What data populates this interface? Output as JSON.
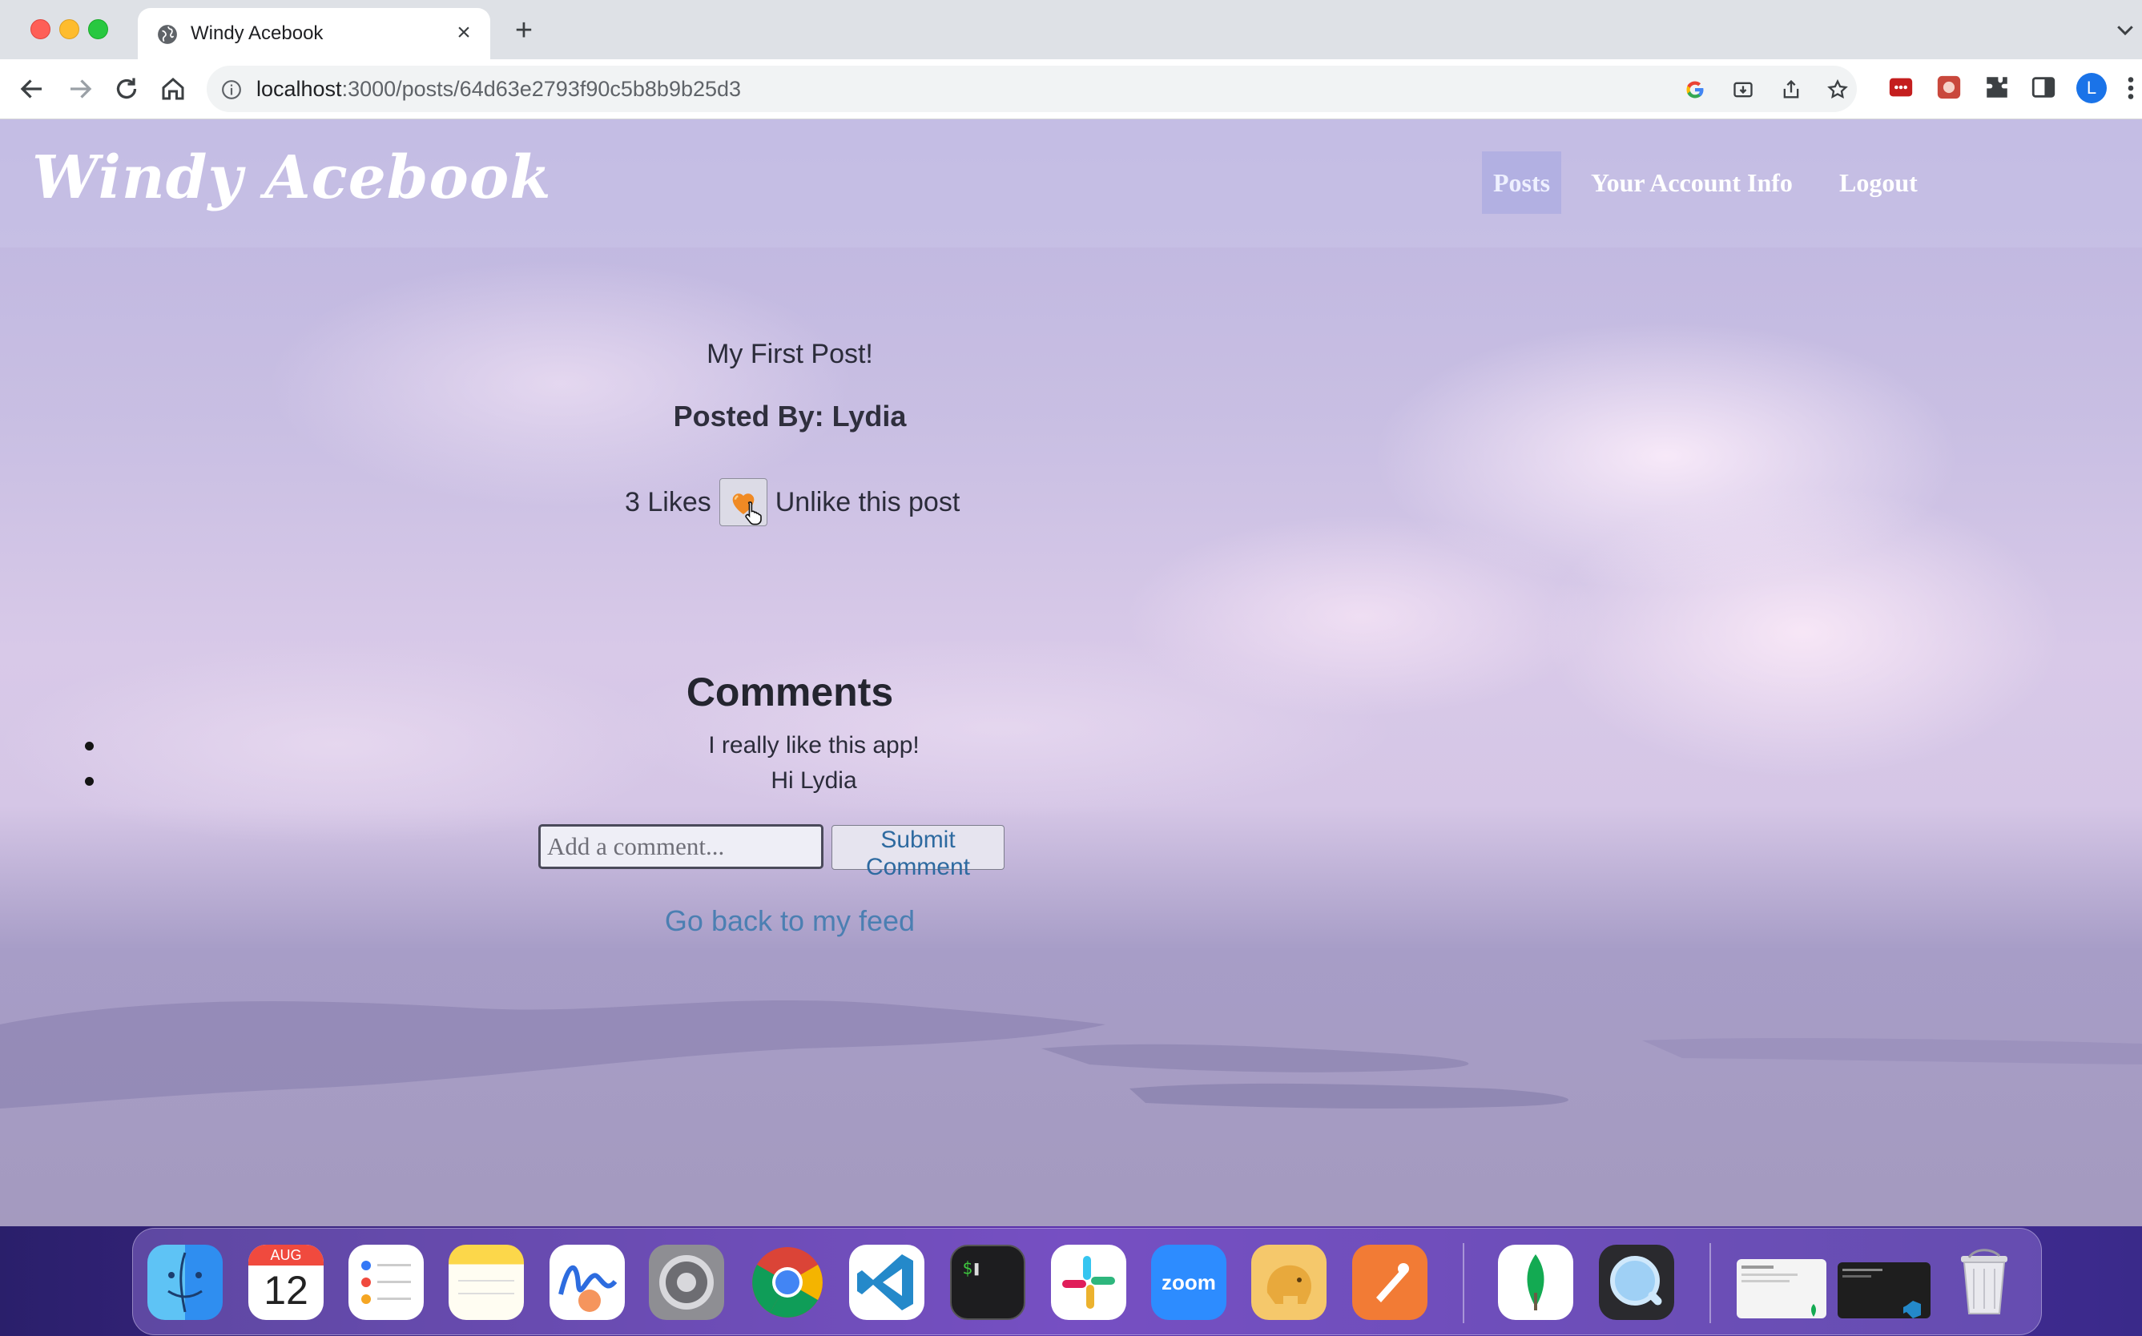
{
  "browser": {
    "tab_title": "Windy Acebook",
    "new_tab_symbol": "+",
    "close_symbol": "×",
    "url_host": "localhost",
    "url_path": ":3000/posts/64d63e2793f90c5b8b9b25d3",
    "profile_initial": "L"
  },
  "site": {
    "logo": "Windy Acebook",
    "nav": {
      "posts": "Posts",
      "account": "Your Account Info",
      "logout": "Logout"
    }
  },
  "post": {
    "message": "My First Post!",
    "posted_by": "Posted By: Lydia",
    "likes": "3 Likes",
    "unlike_label": "Unlike this post"
  },
  "comments": {
    "heading": "Comments",
    "items": [
      "I really like this app!",
      "Hi Lydia"
    ],
    "input_placeholder": "Add a comment...",
    "submit_label": "Submit Comment"
  },
  "back_link": "Go back to my feed",
  "dock": {
    "calendar_month": "AUG",
    "calendar_day": "12",
    "zoom_label": "zoom",
    "apps": [
      "finder-icon",
      "calendar-icon",
      "reminders-icon",
      "notes-icon",
      "freeform-icon",
      "system-settings-icon",
      "chrome-icon",
      "vscode-icon",
      "terminal-icon",
      "slack-icon",
      "zoom-icon",
      "tableplus-icon",
      "postman-icon",
      "mongodb-compass-icon",
      "quicktime-icon",
      "window-thumbnail-icon",
      "terminal-window-thumbnail-icon",
      "trash-icon"
    ]
  }
}
